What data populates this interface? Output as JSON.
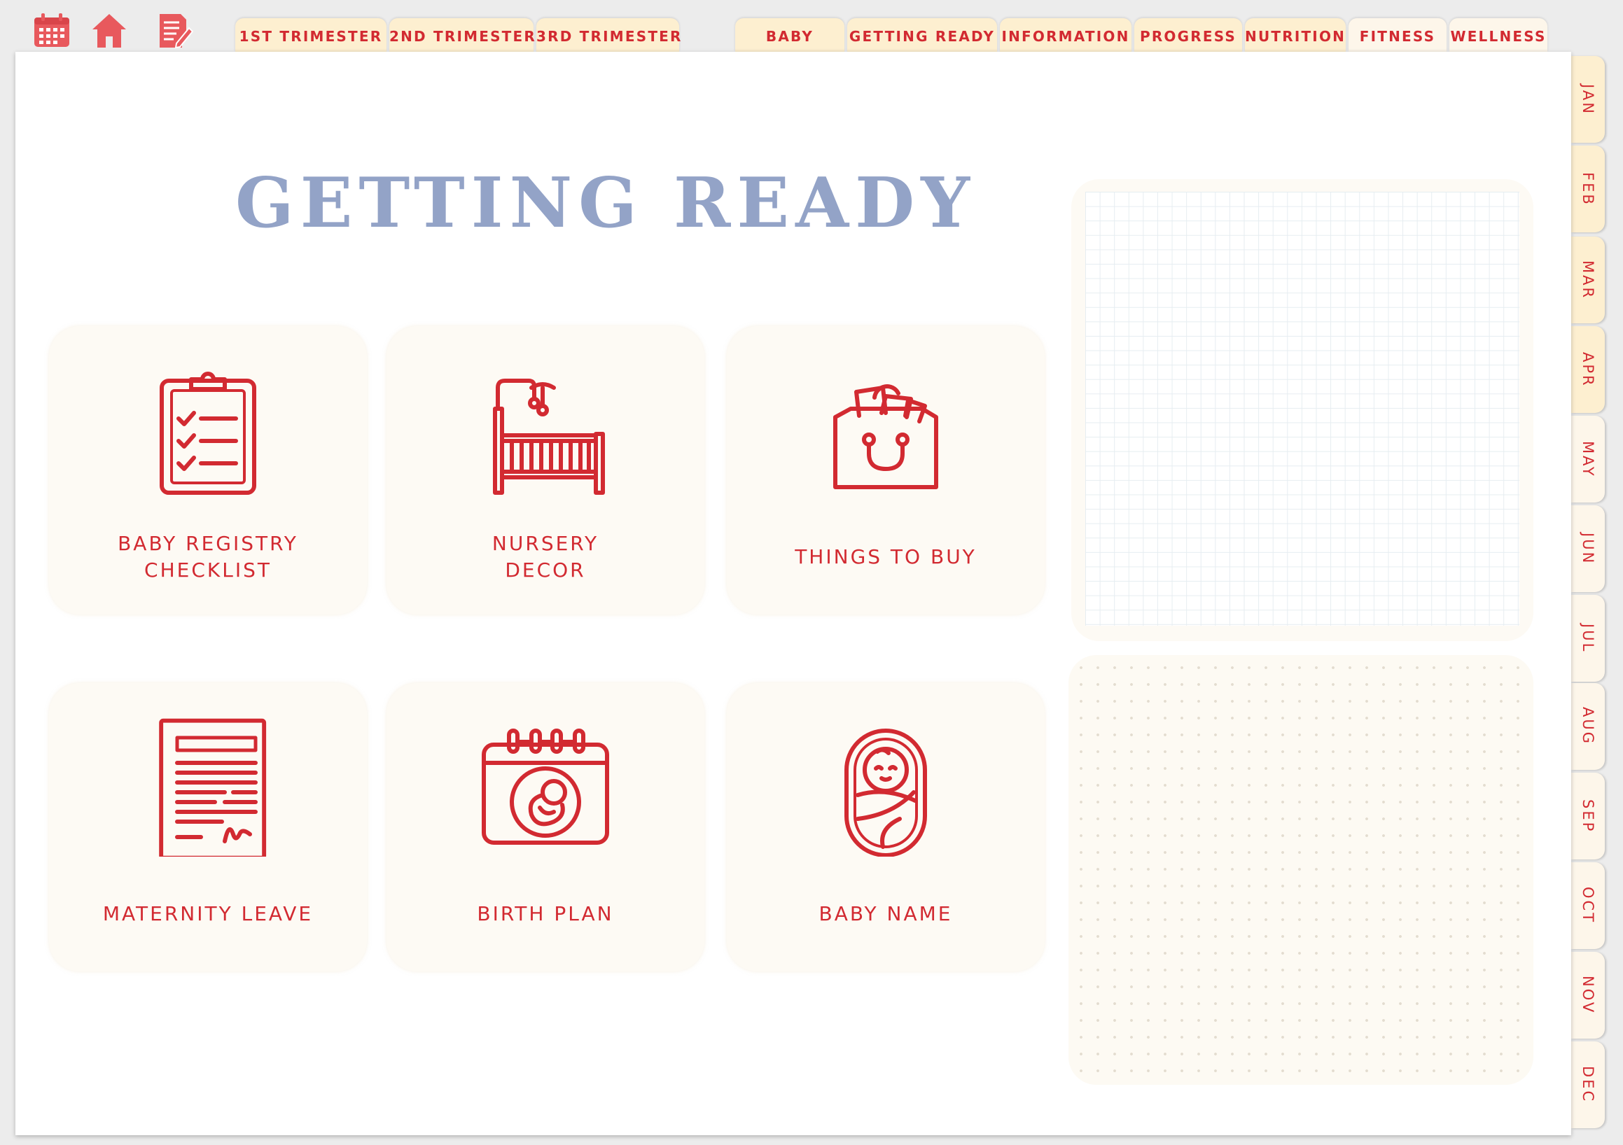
{
  "top_icons": [
    {
      "name": "calendar-icon"
    },
    {
      "name": "home-icon"
    },
    {
      "name": "notes-edit-icon"
    }
  ],
  "trimester_tabs": [
    {
      "label": "1ST TRIMESTER"
    },
    {
      "label": "2ND TRIMESTER"
    },
    {
      "label": "3RD TRIMESTER"
    }
  ],
  "section_tabs": [
    {
      "label": "BABY"
    },
    {
      "label": "GETTING READY"
    },
    {
      "label": "INFORMATION"
    },
    {
      "label": "PROGRESS"
    },
    {
      "label": "NUTRITION"
    },
    {
      "label": "FITNESS"
    },
    {
      "label": "WELLNESS"
    }
  ],
  "page": {
    "title": "GETTING READY"
  },
  "cards": [
    {
      "label": "BABY REGISTRY\nCHECKLIST",
      "icon": "clipboard-checklist-icon"
    },
    {
      "label": "NURSERY\nDECOR",
      "icon": "crib-icon"
    },
    {
      "label": "THINGS TO BUY",
      "icon": "shopping-bag-icon"
    },
    {
      "label": "MATERNITY LEAVE",
      "icon": "document-icon"
    },
    {
      "label": "BIRTH PLAN",
      "icon": "birth-calendar-icon"
    },
    {
      "label": "BABY NAME",
      "icon": "swaddled-baby-icon"
    }
  ],
  "months": [
    "JAN",
    "FEB",
    "MAR",
    "APR",
    "MAY",
    "JUN",
    "JUL",
    "AUG",
    "SEP",
    "OCT",
    "NOV",
    "DEC"
  ],
  "colors": {
    "accent": "#d22a31",
    "title": "#93a3c7",
    "tab": "#fdefd0",
    "card": "#fdfaf4"
  }
}
